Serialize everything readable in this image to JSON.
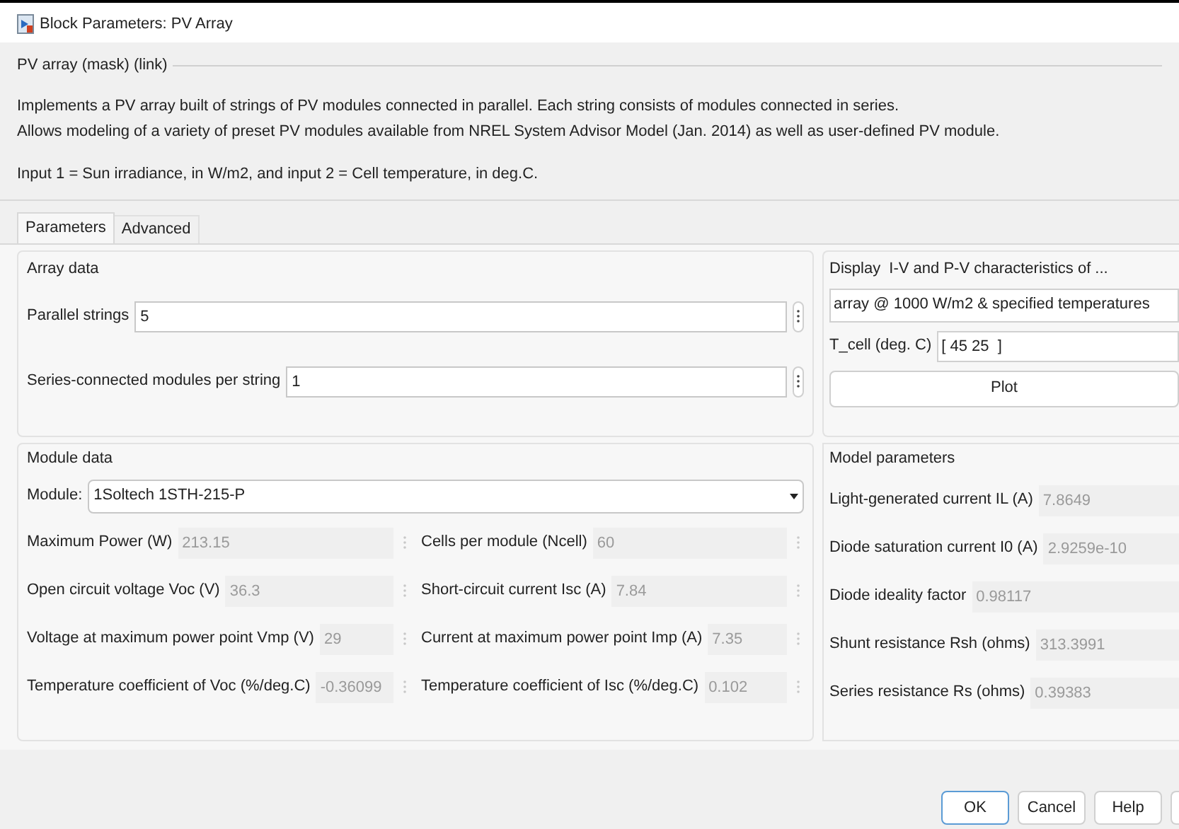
{
  "window": {
    "title": "Block Parameters: PV Array"
  },
  "mask": {
    "title": "PV array (mask) (link)",
    "lines": [
      "Implements a PV array built of strings of PV modules connected in parallel. Each string consists of modules connected in series.",
      "Allows modeling of a variety of preset PV modules available from NREL System Advisor Model (Jan. 2014) as well as user-defined PV module.",
      "Input 1 = Sun irradiance, in W/m2, and input 2 = Cell temperature, in deg.C."
    ]
  },
  "tabs": [
    {
      "label": "Parameters",
      "selected": true
    },
    {
      "label": "Advanced",
      "selected": false
    }
  ],
  "array_data": {
    "title": "Array data",
    "fields": [
      {
        "label": "Parallel strings",
        "value": "5",
        "disabled": false
      },
      {
        "label": "Series-connected modules per string",
        "value": "1",
        "disabled": false
      }
    ]
  },
  "display": {
    "title": "Display  I-V and P-V characteristics of ...",
    "selection": "array @ 1000 W/m2 & specified temperatures",
    "t_cell": {
      "label": "T_cell (deg. C)",
      "value": "[ 45 25  ]"
    },
    "plot_button": "Plot"
  },
  "module_data": {
    "title": "Module data",
    "module": {
      "label": "Module:",
      "value": "1Soltech 1STH-215-P"
    },
    "fields": [
      {
        "label": "Maximum Power (W)",
        "value": "213.15",
        "disabled": true
      },
      {
        "label": "Cells per module (Ncell)",
        "value": "60",
        "disabled": true
      },
      {
        "label": "Open circuit voltage  Voc (V)",
        "value": "36.3",
        "disabled": true
      },
      {
        "label": "Short-circuit current Isc (A)",
        "value": "7.84",
        "disabled": true
      },
      {
        "label": "Voltage at maximum power point Vmp (V)",
        "value": "29",
        "disabled": true
      },
      {
        "label": "Current at maximum power point Imp (A)",
        "value": "7.35",
        "disabled": true
      },
      {
        "label": "Temperature coefficient of Voc (%/deg.C)",
        "value": "-0.36099",
        "disabled": true
      },
      {
        "label": "Temperature coefficient of Isc (%/deg.C)",
        "value": "0.102",
        "disabled": true
      }
    ]
  },
  "model_parameters": {
    "title": "Model parameters",
    "fields": [
      {
        "label": "Light-generated current IL (A)",
        "value": "7.8649",
        "disabled": true
      },
      {
        "label": "Diode saturation current I0 (A)",
        "value": "2.9259e-10",
        "disabled": true
      },
      {
        "label": "Diode ideality factor",
        "value": "0.98117",
        "disabled": true
      },
      {
        "label": "Shunt resistance Rsh (ohms)",
        "value": "313.3991",
        "disabled": true
      },
      {
        "label": "Series resistance Rs (ohms)",
        "value": "0.39383",
        "disabled": true
      }
    ]
  },
  "buttons": [
    {
      "label": "OK",
      "focused": true
    },
    {
      "label": "Cancel",
      "focused": false
    },
    {
      "label": "Help",
      "focused": false
    }
  ]
}
